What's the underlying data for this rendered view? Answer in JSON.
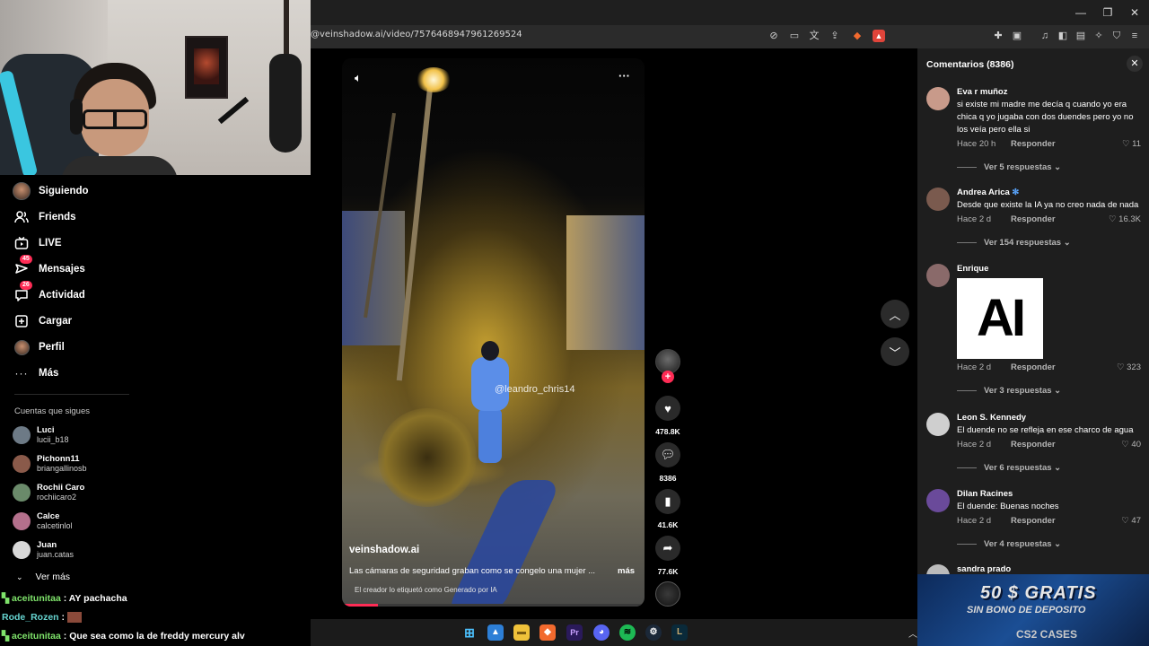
{
  "browser": {
    "url": "@veinshadow.ai/video/7576468947961269524",
    "window_controls": [
      "—",
      "❐",
      "✕"
    ],
    "toolbar_icons": [
      "mute-tab-icon",
      "screenshot-icon",
      "translate-icon",
      "share-icon",
      "brave-shields-icon",
      "brave-rewards-icon",
      "extensions-icon",
      "tab-search-icon",
      "media-icon",
      "sidebar-icon",
      "wallet-icon",
      "leo-icon",
      "vpn-icon",
      "menu-icon"
    ]
  },
  "sidebar": {
    "nav": [
      {
        "label": "Siguiendo",
        "icon": "avatar"
      },
      {
        "label": "Friends",
        "icon": "friends-icon"
      },
      {
        "label": "LIVE",
        "icon": "live-icon"
      },
      {
        "label": "Mensajes",
        "icon": "messages-icon",
        "badge": "45"
      },
      {
        "label": "Actividad",
        "icon": "activity-icon",
        "badge": "26"
      },
      {
        "label": "Cargar",
        "icon": "upload-icon"
      },
      {
        "label": "Perfil",
        "icon": "avatar"
      },
      {
        "label": "Más",
        "icon": "more-icon"
      }
    ],
    "following_title": "Cuentas que sigues",
    "following": [
      {
        "name": "Luci",
        "handle": "lucii_b18",
        "color": "#6d7a86"
      },
      {
        "name": "Pichonn11",
        "handle": "briangallinosb",
        "color": "#8a5a4a"
      },
      {
        "name": "Rochii Caro",
        "handle": "rochiicaro2",
        "color": "#6a8a6a"
      },
      {
        "name": "Calce",
        "handle": "calcetinlol",
        "color": "#b4708c"
      },
      {
        "name": "Juan",
        "handle": "juan.catas",
        "color": "#d8d8d8"
      }
    ],
    "see_more": "Ver más"
  },
  "chat": [
    {
      "user": "aceitunitaa",
      "message": ": AY pachacha"
    },
    {
      "user": "Rode_Rozen",
      "message": ":"
    },
    {
      "user": "aceitunitaa",
      "message": ": Que sea como la de freddy mercury alv"
    }
  ],
  "video": {
    "watermark": "@leandro_chris14",
    "account": "veinshadow.ai",
    "caption": "Las cámaras de seguridad graban como se congelo una mujer ...",
    "more": "más",
    "ai_label": "El creador lo etiquetó como Generado por IA",
    "progress": 0.12,
    "likes": "478.8K",
    "comments": "8386",
    "saves": "41.6K",
    "shares": "77.6K"
  },
  "comments_panel": {
    "title": "Comentarios (8386)",
    "items": [
      {
        "user": "Eva r muñoz",
        "text": "si existe mi madre me decía q cuando yo era chica q yo jugaba con dos duendes pero yo no los veía pero ella si",
        "time": "Hace 20 h",
        "reply": "Responder",
        "likes": "11",
        "view": "Ver 5 respuestas",
        "color": "#c89a8a"
      },
      {
        "user": "Andrea  Arica",
        "verified": true,
        "text": "Desde que existe la IA ya no creo nada de nada",
        "time": "Hace 2 d",
        "reply": "Responder",
        "likes": "16.3K",
        "view": "Ver 154 respuestas",
        "color": "#7a5a4e"
      },
      {
        "user": "Enrique",
        "image_text": "AI",
        "time": "Hace 2 d",
        "reply": "Responder",
        "likes": "323",
        "view": "Ver 3 respuestas",
        "color": "#8a6a6a"
      },
      {
        "user": "Leon S. Kennedy",
        "text": "El duende no se refleja en ese charco de agua",
        "time": "Hace 2 d",
        "reply": "Responder",
        "likes": "40",
        "view": "Ver 6 respuestas",
        "color": "#cfcfcf"
      },
      {
        "user": "Dilan Racines",
        "text": "El duende: Buenas noches",
        "time": "Hace 2 d",
        "reply": "Responder",
        "likes": "47",
        "view": "Ver 4 respuestas",
        "color": "#6a4a9a"
      },
      {
        "user": "sandra prado",
        "color": "#bbbbbb"
      }
    ]
  },
  "ad": {
    "headline": "50 $ GRATIS",
    "sub": "SIN BONO DE DEPOSITO",
    "brand": "CS2 CASES"
  },
  "taskbar_icons": [
    "windows-icon",
    "photos-icon",
    "folder-icon",
    "brave-icon",
    "premiere-icon",
    "discord-icon",
    "spotify-icon",
    "steam-icon",
    "league-icon"
  ]
}
